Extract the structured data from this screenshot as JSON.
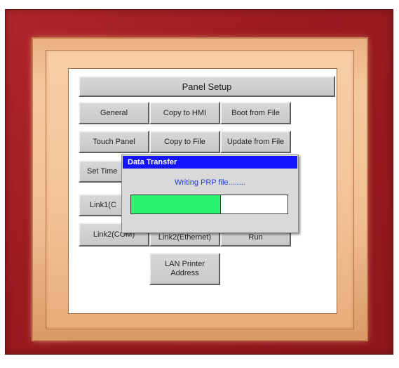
{
  "panel": {
    "title": "Panel Setup",
    "buttons": {
      "general": "General",
      "copy_to_hmi": "Copy to HMI",
      "boot_from_file": "Boot from File",
      "touch_panel": "Touch Panel",
      "copy_to_file": "Copy to File",
      "update_from_file": "Update from File",
      "set_time": "Set Time",
      "link1_com": "Link1(C",
      "link2_com": "Link2(COM)",
      "link2_ethernet": "Link2(Ethernet)",
      "run": "Run",
      "lan_printer_address": "LAN Printer\nAddress"
    }
  },
  "dialog": {
    "title": "Data Transfer",
    "message": "Writing PRP file........",
    "progress_fraction": 0.57
  },
  "colors": {
    "bezel_red": "#9a1b20",
    "frame_tan": "#f4c59a",
    "dialog_title_bar": "#1414ff",
    "progress_green": "#29f56e",
    "message_text": "#1f3ad6"
  }
}
